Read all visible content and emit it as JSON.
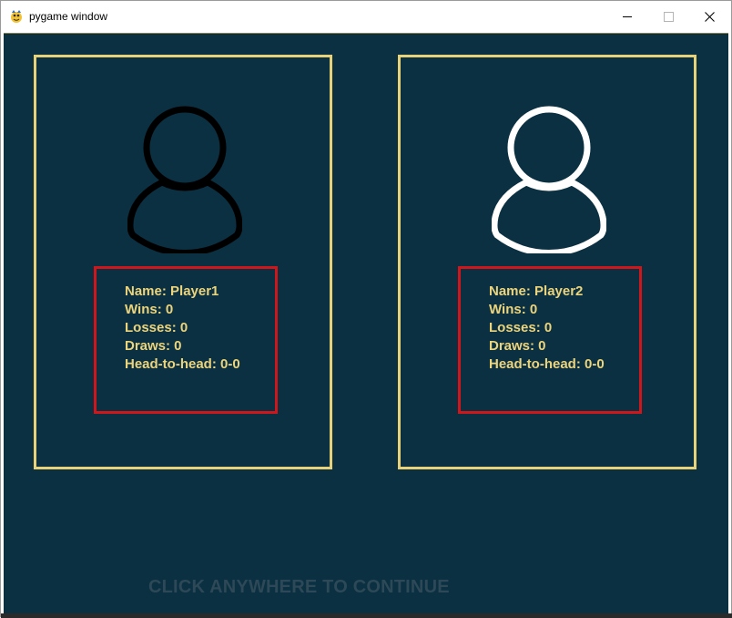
{
  "window": {
    "title": "pygame window",
    "app_icon": "pygame-snake-icon",
    "controls": [
      "minimize-icon",
      "maximize-icon",
      "close-icon"
    ]
  },
  "colors": {
    "background": "#0a3042",
    "panel_border": "#e7d27a",
    "stats_border": "#d1161b",
    "stats_text": "#ecd47c",
    "player1_avatar": "#000000",
    "player2_avatar": "#ffffff",
    "continue_text": "#2d4856"
  },
  "players": [
    {
      "avatar_icon": "user-silhouette-icon",
      "lines": {
        "name": "Name: Player1",
        "wins": "Wins: 0",
        "losses": "Losses: 0",
        "draws": "Draws: 0",
        "head_to_head": "Head-to-head: 0-0"
      }
    },
    {
      "avatar_icon": "user-silhouette-icon",
      "lines": {
        "name": "Name: Player2",
        "wins": "Wins: 0",
        "losses": "Losses: 0",
        "draws": "Draws: 0",
        "head_to_head": "Head-to-head: 0-0"
      }
    }
  ],
  "prompt": {
    "continue_text": "CLICK ANYWHERE TO CONTINUE"
  }
}
